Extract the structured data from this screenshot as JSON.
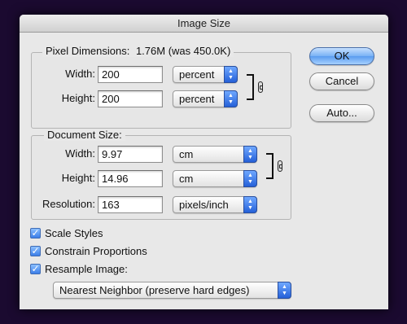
{
  "dialog": {
    "title": "Image Size"
  },
  "pixel_dimensions": {
    "legend_prefix": "Pixel Dimensions:",
    "size": "1.76M (was 450.0K)",
    "width_label": "Width:",
    "width_value": "200",
    "width_unit": "percent",
    "height_label": "Height:",
    "height_value": "200",
    "height_unit": "percent"
  },
  "document_size": {
    "legend": "Document Size:",
    "width_label": "Width:",
    "width_value": "9.97",
    "width_unit": "cm",
    "height_label": "Height:",
    "height_value": "14.96",
    "height_unit": "cm",
    "resolution_label": "Resolution:",
    "resolution_value": "163",
    "resolution_unit": "pixels/inch"
  },
  "buttons": {
    "ok": "OK",
    "cancel": "Cancel",
    "auto": "Auto..."
  },
  "options": {
    "scale_styles": "Scale Styles",
    "scale_styles_checked": true,
    "constrain_proportions": "Constrain Proportions",
    "constrain_proportions_checked": true,
    "resample_image": "Resample Image:",
    "resample_image_checked": true,
    "resample_method": "Nearest Neighbor (preserve hard edges)"
  },
  "icons": {
    "stepper": "up-down-arrows-icon",
    "link": "chain-link-icon",
    "check": "checkmark-icon"
  },
  "colors": {
    "default_button": "#5a9cef",
    "stepper": "#2560d8",
    "background": "#1b0a30"
  }
}
